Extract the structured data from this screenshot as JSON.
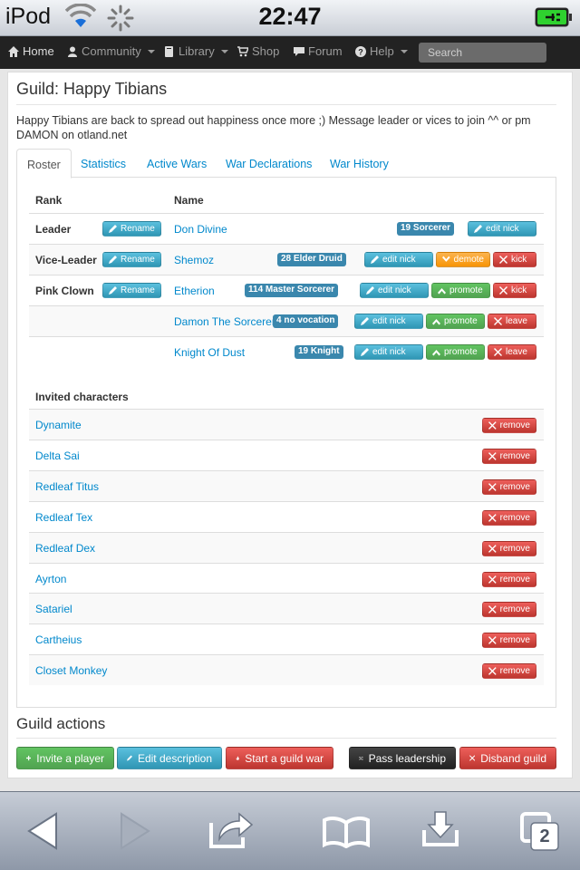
{
  "status_bar": {
    "carrier": "iPod",
    "time": "22:47"
  },
  "nav": {
    "items": [
      {
        "label": "Home",
        "icon": "home-icon",
        "dropdown": false
      },
      {
        "label": "Community",
        "icon": "user-icon",
        "dropdown": true
      },
      {
        "label": "Library",
        "icon": "book-icon",
        "dropdown": true
      },
      {
        "label": "Shop",
        "icon": "cart-icon",
        "dropdown": false
      },
      {
        "label": "Forum",
        "icon": "comment-icon",
        "dropdown": false
      },
      {
        "label": "Help",
        "icon": "question-icon",
        "dropdown": true
      }
    ],
    "search_placeholder": "Search"
  },
  "guild": {
    "title": "Guild: Happy Tibians",
    "description": "Happy Tibians are back to spread out happiness once more ;) Message leader or vices to join ^^ or pm DAMON on otland.net"
  },
  "tabs": [
    "Roster",
    "Statistics",
    "Active Wars",
    "War Declarations",
    "War History"
  ],
  "roster": {
    "rank_header": "Rank",
    "name_header": "Name",
    "rename_label": "Rename",
    "rows": [
      {
        "rank": "Leader",
        "name": "Don Divine",
        "vocation": "19 Sorcerer",
        "actions": [
          {
            "label": "edit nick",
            "style": "info",
            "icon": "pencil-icon"
          }
        ]
      },
      {
        "rank": "Vice-Leader",
        "name": "Shemoz",
        "vocation": "28 Elder Druid",
        "actions": [
          {
            "label": "edit nick",
            "style": "info",
            "icon": "pencil-icon"
          },
          {
            "label": "demote",
            "style": "warning",
            "icon": "chevron-down-icon"
          },
          {
            "label": "kick",
            "style": "danger",
            "icon": "x-icon"
          }
        ]
      },
      {
        "rank": "Pink Clown",
        "name": "Etherion",
        "vocation": "114 Master Sorcerer",
        "actions": [
          {
            "label": "edit nick",
            "style": "info",
            "icon": "pencil-icon"
          },
          {
            "label": "promote",
            "style": "success",
            "icon": "chevron-up-icon"
          },
          {
            "label": "kick",
            "style": "danger",
            "icon": "x-icon"
          }
        ]
      },
      {
        "rank": "",
        "name": "Damon The Sorcerer",
        "vocation": "4 no vocation",
        "actions": [
          {
            "label": "edit nick",
            "style": "info",
            "icon": "pencil-icon"
          },
          {
            "label": "promote",
            "style": "success",
            "icon": "chevron-up-icon"
          },
          {
            "label": "leave",
            "style": "danger",
            "icon": "x-icon"
          }
        ]
      },
      {
        "rank": "",
        "name": "Knight Of Dust",
        "vocation": "19 Knight",
        "actions": [
          {
            "label": "edit nick",
            "style": "info",
            "icon": "pencil-icon"
          },
          {
            "label": "promote",
            "style": "success",
            "icon": "chevron-up-icon"
          },
          {
            "label": "leave",
            "style": "danger",
            "icon": "x-icon"
          }
        ]
      }
    ]
  },
  "invited": {
    "header": "Invited characters",
    "remove_label": "remove",
    "names": [
      "Dynamite",
      "Delta Sai",
      "Redleaf Titus",
      "Redleaf Tex",
      "Redleaf Dex",
      "Ayrton",
      "Satariel",
      "Cartheius",
      "Closet Monkey"
    ]
  },
  "guild_actions": {
    "header": "Guild actions",
    "buttons": [
      {
        "label": "Invite a player",
        "style": "success",
        "icon": "plus-icon"
      },
      {
        "label": "Edit description",
        "style": "info",
        "icon": "pencil-icon"
      },
      {
        "label": "Start a guild war",
        "style": "danger",
        "icon": "fire-icon"
      },
      {
        "label": "Pass leadership",
        "style": "inverse",
        "icon": "random-icon"
      },
      {
        "label": "Disband guild",
        "style": "danger",
        "icon": "x-icon"
      }
    ]
  },
  "toolbar": {
    "tabs_count": "2"
  },
  "colors": {
    "link": "#0088cc",
    "info": "#2f96b4",
    "danger": "#bd362f",
    "success": "#51a351",
    "warning": "#f89406",
    "badge": "#3a87ad",
    "navbar": "#222222"
  }
}
